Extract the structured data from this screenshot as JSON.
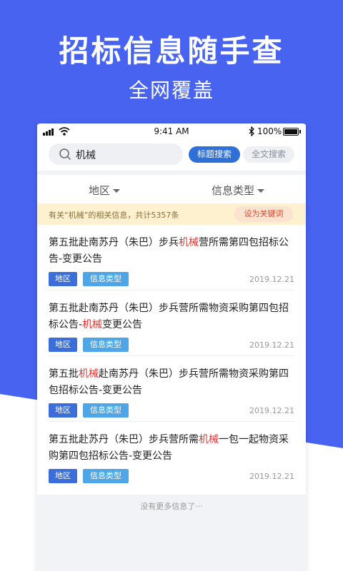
{
  "hero": {
    "title": "招标信息随手查",
    "subtitle": "全网覆盖"
  },
  "status_bar": {
    "time": "9:41 AM",
    "battery": "100%"
  },
  "search": {
    "query": "机械",
    "title_search_label": "标题搜索",
    "fulltext_search_label": "全文搜索"
  },
  "filters": {
    "region_label": "地区",
    "type_label": "信息类型"
  },
  "notice": {
    "text": "有关“机械”的相关信息，共计5357条",
    "keyword_button": "设为关键词"
  },
  "results": [
    {
      "title_parts": [
        "第五批赴南苏丹（朱巴）步兵",
        "机械",
        "营所需第四包招标公告-变更公告"
      ],
      "tag_region": "地区",
      "tag_type": "信息类型",
      "date": "2019.12.21"
    },
    {
      "title_parts": [
        "第五批赴南苏丹（朱巴）步兵营所需物资采购第四包招标公告-",
        "机械",
        "变更公告"
      ],
      "tag_region": "地区",
      "tag_type": "信息类型",
      "date": "2019.12.21"
    },
    {
      "title_parts": [
        "第五批",
        "机械",
        "赴南苏丹（朱巴）步兵营所需物资采购第四包招标公告-变更公告"
      ],
      "tag_region": "地区",
      "tag_type": "信息类型",
      "date": "2019.12.21"
    },
    {
      "title_parts": [
        "第五批赴苏丹（朱巴）步兵营所需",
        "机械",
        "一包一起物资采购第四包招标公告-变更公告"
      ],
      "tag_region": "地区",
      "tag_type": "信息类型",
      "date": "2019.12.21"
    }
  ],
  "list_footer": "没有更多信息了···",
  "colors": {
    "hero_blue": "#4763f0",
    "primary_button": "#2f6fd8",
    "highlight_red": "#e8322e",
    "tag_region": "#3c6ed9",
    "tag_type": "#4fa6e6",
    "notice_bg": "#fdf1cf"
  },
  "icons": [
    "signal-icon",
    "wifi-icon",
    "bluetooth-icon",
    "battery-icon",
    "search-icon",
    "caret-down-icon"
  ]
}
